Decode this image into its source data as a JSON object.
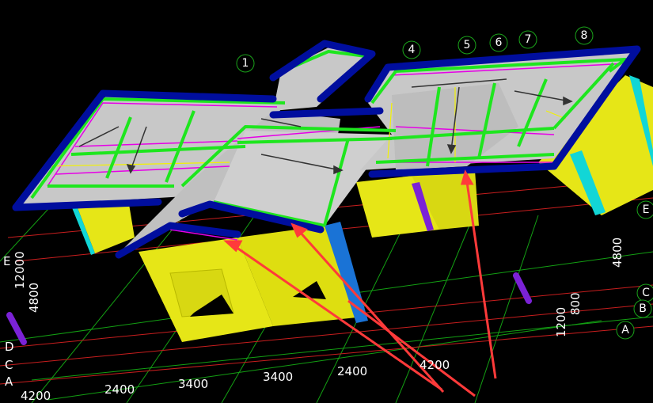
{
  "axis_numbers_top": [
    "1",
    "4",
    "5",
    "6",
    "7",
    "8"
  ],
  "axis_letters_right": [
    "E",
    "C",
    "B",
    "A"
  ],
  "axis_letters_left": [
    "E",
    "D",
    "C",
    "A"
  ],
  "dims_bottom": [
    "4200",
    "2400",
    "3400",
    "3400",
    "2400",
    "4200"
  ],
  "dims_right": [
    "4800",
    "800",
    "1200"
  ],
  "dims_left": [
    "12000",
    "4800"
  ],
  "colors": {
    "background": "#000000",
    "yellow_wall": "#e6e617",
    "roof_gray": "#c8c8c8",
    "beam_blue": "#000e9e",
    "green_line": "#1ee61e",
    "magenta_line": "#e600e6",
    "arrow_red": "#ff3a3a",
    "grid_red": "#c81e1e",
    "grid_green": "#13a013",
    "cyan": "#12d6d6",
    "purple": "#7b22d6"
  }
}
